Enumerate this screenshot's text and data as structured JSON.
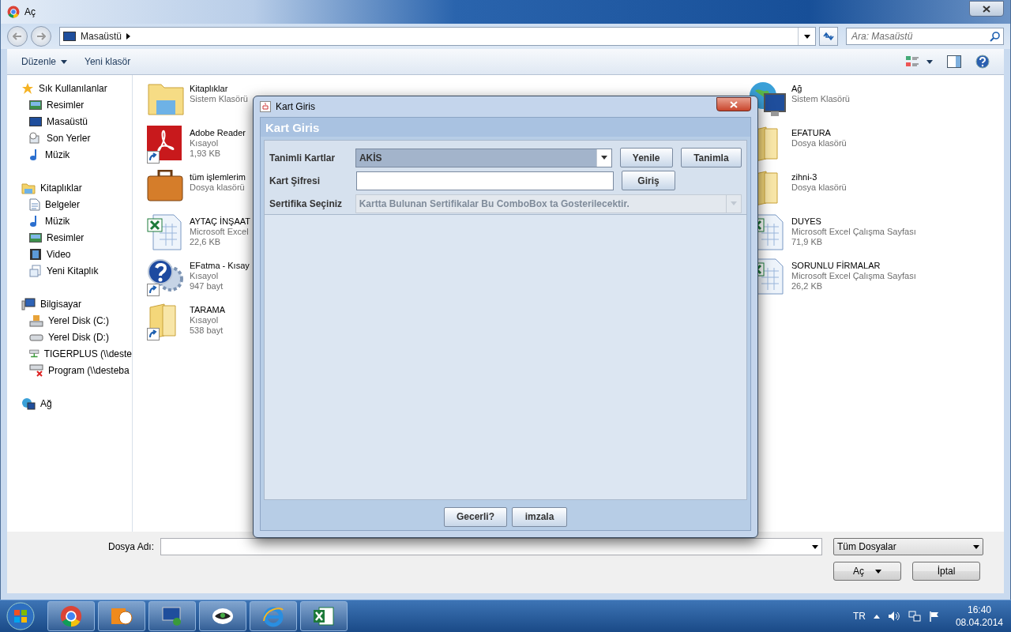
{
  "window": {
    "title": "Aç"
  },
  "address": {
    "path": "Masaüstü",
    "search_placeholder": "Ara: Masaüstü"
  },
  "toolbar": [
    {
      "label": "Düzenle",
      "kind": "menu"
    },
    {
      "label": "Yeni klasör",
      "kind": "button"
    }
  ],
  "sidebar": [
    {
      "label": "Sık Kullanılanlar",
      "kind": "favorites",
      "children": [
        {
          "label": "Resimler",
          "kind": "pictures"
        },
        {
          "label": "Masaüstü",
          "kind": "desktop"
        },
        {
          "label": "Son Yerler",
          "kind": "recent"
        },
        {
          "label": "Müzik",
          "kind": "music"
        }
      ]
    },
    {
      "label": "Kitaplıklar",
      "kind": "library",
      "children": [
        {
          "label": "Belgeler",
          "kind": "documents"
        },
        {
          "label": "Müzik",
          "kind": "music"
        },
        {
          "label": "Resimler",
          "kind": "pictures"
        },
        {
          "label": "Video",
          "kind": "video"
        },
        {
          "label": "Yeni Kitaplık",
          "kind": "newlibrary"
        }
      ]
    },
    {
      "label": "Bilgisayar",
      "kind": "computer",
      "children": [
        {
          "label": "Yerel Disk (C:)",
          "kind": "systemdisk"
        },
        {
          "label": "Yerel Disk (D:)",
          "kind": "disk"
        },
        {
          "label": "TIGERPLUS (\\\\deste",
          "kind": "netdrive"
        },
        {
          "label": "Program (\\\\desteba",
          "kind": "netdrive_off"
        }
      ]
    },
    {
      "label": "Ağ",
      "kind": "network"
    }
  ],
  "file_groups": [
    [
      {
        "name": "Kitaplıklar",
        "details": [
          "Sistem Klasörü"
        ],
        "kind": "library",
        "shortcut": false
      },
      {
        "name": "Adobe Reader",
        "details": [
          "Kısayol",
          "1,93 KB"
        ],
        "kind": "pdf",
        "shortcut": true
      },
      {
        "name": "tüm işlemlerim",
        "details": [
          "Dosya klasörü"
        ],
        "kind": "briefcase",
        "shortcut": false
      },
      {
        "name": "AYTAÇ İNŞAAT",
        "details": [
          "Microsoft Excel",
          "22,6 KB"
        ],
        "kind": "spreadsheet",
        "shortcut": false
      },
      {
        "name": "EFatma - Kısay",
        "details": [
          "Kısayol",
          "947 bayt"
        ],
        "kind": "help",
        "shortcut": true
      },
      {
        "name": "TARAMA",
        "details": [
          "Kısayol",
          "538 bayt"
        ],
        "kind": "folder",
        "shortcut": true
      }
    ],
    [
      {
        "name": "Ağ",
        "details": [
          "Sistem Klasörü"
        ],
        "kind": "network",
        "shortcut": false
      },
      {
        "name": "EFATURA",
        "details": [
          "Dosya klasörü"
        ],
        "kind": "folder",
        "shortcut": false
      },
      {
        "name": "zihni-3",
        "details": [
          "Dosya klasörü"
        ],
        "kind": "folder",
        "shortcut": false
      },
      {
        "name": "DUYES",
        "details": [
          "Microsoft Excel Çalışma Sayfası",
          "71,9 KB"
        ],
        "kind": "spreadsheet",
        "shortcut": false
      },
      {
        "name": "SORUNLU FİRMALAR",
        "details": [
          "Microsoft Excel Çalışma Sayfası",
          "26,2 KB"
        ],
        "kind": "spreadsheet",
        "shortcut": false
      }
    ]
  ],
  "footer": {
    "filename_label": "Dosya Adı:",
    "filter": "Tüm Dosyalar",
    "open_button": "Aç",
    "cancel_button": "İptal"
  },
  "dialog": {
    "title": "Kart Giris",
    "header": "Kart Giris",
    "cards": {
      "label": "Tanimli Kartlar",
      "value": "AKİS",
      "buttons": [
        "Yenile",
        "Tanimla"
      ]
    },
    "password": {
      "label": "Kart Şifresi",
      "button": "Giriş"
    },
    "certificate": {
      "label": "Sertifika Seçiniz",
      "value": "Kartta Bulunan Sertifikalar Bu ComboBox ta Gosterilecektir.",
      "disabled": true
    },
    "buttons": [
      "Gecerli?",
      "imzala"
    ]
  },
  "taskbar": {
    "language": "TR",
    "time": "16:40",
    "date": "08.04.2014"
  }
}
